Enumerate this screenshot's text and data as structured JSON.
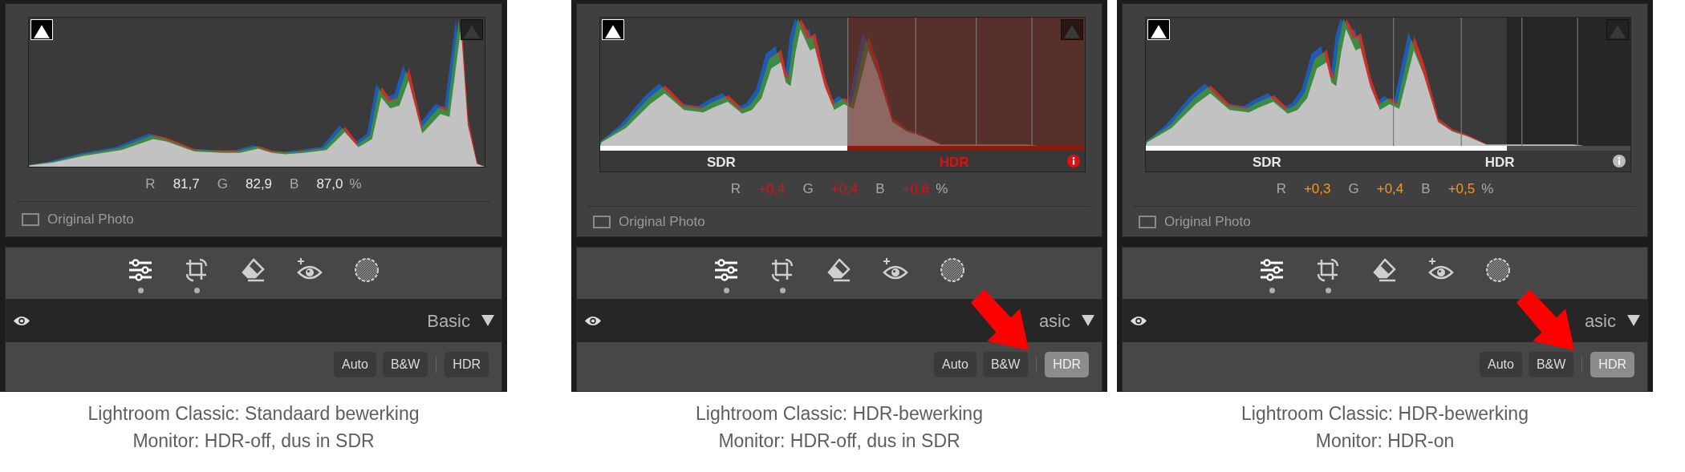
{
  "panels": [
    {
      "histogram": {
        "kind": "sdr",
        "shadow_clipping": true,
        "highlight_clipping": false
      },
      "readout": {
        "kind": "neutral",
        "channels": [
          {
            "label": "R",
            "value": "81,7"
          },
          {
            "label": "G",
            "value": "82,9"
          },
          {
            "label": "B",
            "value": "87,0"
          }
        ],
        "unit": "%"
      },
      "original_photo": {
        "label": "Original Photo",
        "checked": false
      },
      "tools": [
        {
          "dot": true
        },
        {
          "dot": true
        },
        {
          "dot": false
        },
        {
          "dot": false
        },
        {
          "dot": false
        }
      ],
      "section": {
        "title": "Basic"
      },
      "buttons": [
        {
          "label": "Auto",
          "selected": false
        },
        {
          "label": "B&W",
          "selected": false
        },
        {
          "label": "HDR",
          "selected": false
        }
      ],
      "arrow": false,
      "caption": [
        "Lightroom Classic: Standaard bewerking",
        "Monitor: HDR-off, dus in SDR"
      ]
    },
    {
      "histogram": {
        "kind": "hdr_preview",
        "shadow_clipping": true,
        "highlight_clipping": false,
        "scale_labels": [
          "SDR",
          "HDR"
        ]
      },
      "readout": {
        "kind": "over",
        "channels": [
          {
            "label": "R",
            "value": "+0,4"
          },
          {
            "label": "G",
            "value": "+0,4"
          },
          {
            "label": "B",
            "value": "+0,6"
          }
        ],
        "unit": "%"
      },
      "original_photo": {
        "label": "Original Photo",
        "checked": false
      },
      "tools": [
        {
          "dot": true
        },
        {
          "dot": true
        },
        {
          "dot": false
        },
        {
          "dot": false
        },
        {
          "dot": false
        }
      ],
      "section": {
        "title": "asic"
      },
      "buttons": [
        {
          "label": "Auto",
          "selected": false
        },
        {
          "label": "B&W",
          "selected": false
        },
        {
          "label": "HDR",
          "selected": true
        }
      ],
      "arrow": true,
      "caption": [
        "Lightroom Classic: HDR-bewerking",
        "Monitor: HDR-off, dus in SDR"
      ]
    },
    {
      "histogram": {
        "kind": "hdr",
        "shadow_clipping": true,
        "highlight_clipping": false,
        "scale_labels": [
          "SDR",
          "HDR"
        ]
      },
      "readout": {
        "kind": "headroom",
        "channels": [
          {
            "label": "R",
            "value": "+0,3"
          },
          {
            "label": "G",
            "value": "+0,4"
          },
          {
            "label": "B",
            "value": "+0,5"
          }
        ],
        "unit": "%"
      },
      "original_photo": {
        "label": "Original Photo",
        "checked": false
      },
      "tools": [
        {
          "dot": true
        },
        {
          "dot": true
        },
        {
          "dot": false
        },
        {
          "dot": false
        },
        {
          "dot": false
        }
      ],
      "section": {
        "title": "asic"
      },
      "buttons": [
        {
          "label": "Auto",
          "selected": false
        },
        {
          "label": "B&W",
          "selected": false
        },
        {
          "label": "HDR",
          "selected": true
        }
      ],
      "arrow": true,
      "caption": [
        "Lightroom Classic: HDR-bewerking",
        "Monitor: HDR-on"
      ]
    }
  ]
}
